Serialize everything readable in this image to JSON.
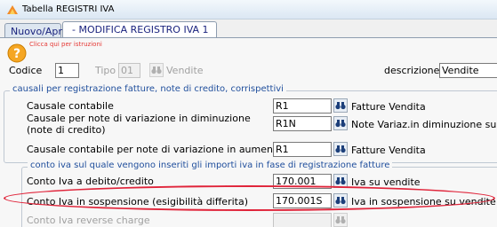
{
  "window": {
    "title": "Tabella REGISTRI IVA"
  },
  "tabs": [
    {
      "label": "Nuovo/Apri"
    },
    {
      "label": "- MODIFICA REGISTRO IVA 1"
    }
  ],
  "help": {
    "text": "Clicca qui per istruzioni"
  },
  "header": {
    "codice_label": "Codice",
    "codice_value": "1",
    "tipo_label": "Tipo",
    "tipo_value": "01",
    "tipo_desc": "Vendite",
    "descrizione_label": "descrizione",
    "descrizione_value": "Vendite"
  },
  "causali_group": {
    "title": "causali per registrazione fatture, note di credito, corrispettivi",
    "rows": [
      {
        "label": "Causale contabile",
        "value": "R1",
        "desc": "Fatture Vendita"
      },
      {
        "label": "Causale per note di variazione in diminuzione (note di credito)",
        "value": "R1N",
        "desc": "Note Variaz.in diminuzione su ve"
      },
      {
        "label": "Causale contabile per note di variazione in aumento",
        "value": "R1",
        "desc": "Fatture Vendita"
      }
    ]
  },
  "conto_group": {
    "title": "conto iva sul quale vengono inseriti gli importi iva in fase di registrazione fatture",
    "rows": [
      {
        "label": "Conto Iva a debito/credito",
        "value": "170.001",
        "desc": "Iva su vendite"
      },
      {
        "label": "Conto Iva in sospensione (esigibilità differita)",
        "value": "170.001S",
        "desc": "Iva in sospensione su vendite"
      },
      {
        "label": "Conto Iva reverse charge",
        "value": "",
        "desc": ""
      }
    ]
  }
}
